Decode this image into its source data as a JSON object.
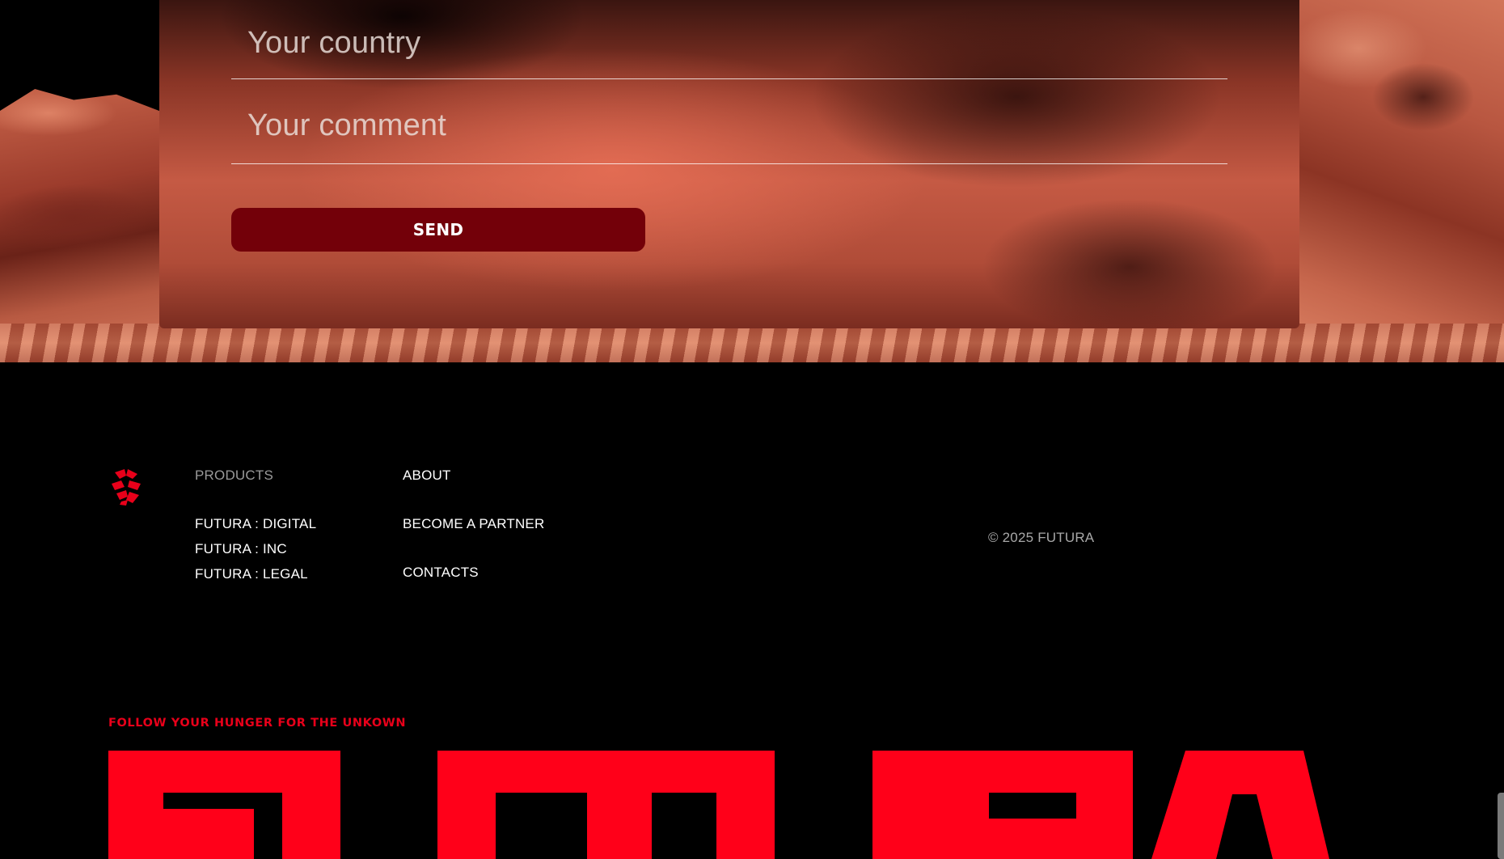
{
  "contact_form": {
    "country_placeholder": "Your country",
    "comment_placeholder": "Your comment",
    "send_label": "SEND"
  },
  "footer": {
    "products_heading": "PRODUCTS",
    "products": [
      "FUTURA : DIGITAL",
      "FUTURA : INC",
      "FUTURA : LEGAL"
    ],
    "links": [
      "ABOUT",
      "BECOME A PARTNER",
      "CONTACTS"
    ],
    "copyright": "©  2025 FUTURA",
    "tagline": "FOLLOW YOUR HUNGER FOR THE UNKOWN",
    "wordmark": "FUTURA"
  },
  "colors": {
    "brand_red": "#e8001a",
    "button_bg": "#730009",
    "background": "#000000"
  },
  "icons": {
    "logo": "futura-logo-icon"
  }
}
